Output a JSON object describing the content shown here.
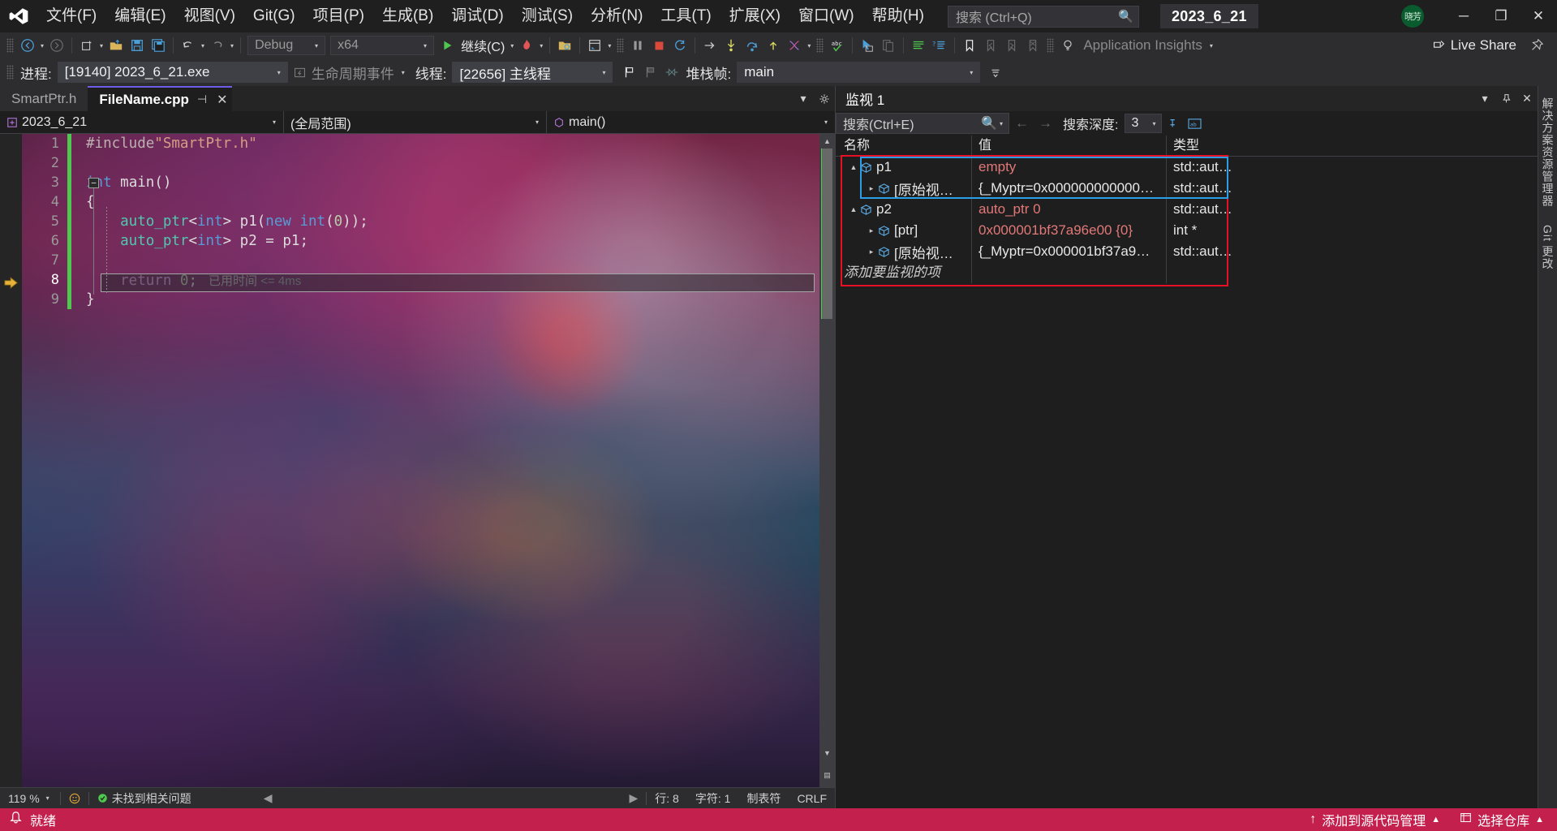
{
  "titlebar": {
    "logo_name": "visual-studio-logo",
    "menu": [
      {
        "label": "文件(F)"
      },
      {
        "label": "编辑(E)"
      },
      {
        "label": "视图(V)"
      },
      {
        "label": "Git(G)"
      },
      {
        "label": "项目(P)"
      },
      {
        "label": "生成(B)"
      },
      {
        "label": "调试(D)"
      },
      {
        "label": "测试(S)"
      },
      {
        "label": "分析(N)"
      },
      {
        "label": "工具(T)"
      },
      {
        "label": "扩展(X)"
      },
      {
        "label": "窗口(W)"
      },
      {
        "label": "帮助(H)"
      }
    ],
    "search_placeholder": "搜索 (Ctrl+Q)",
    "solution_name": "2023_6_21",
    "avatar_initials": "晓芳",
    "minimize": "─",
    "restore": "❐",
    "close": "✕"
  },
  "toolbar": {
    "config_value": "Debug",
    "platform_value": "x64",
    "continue_label": "继续(C)",
    "app_insights_label": "Application Insights",
    "live_share_label": "Live Share"
  },
  "context_bar": {
    "process_label": "进程:",
    "process_value": "[19140] 2023_6_21.exe",
    "lifecycle_label": "生命周期事件",
    "thread_label": "线程:",
    "thread_value": "[22656] 主线程",
    "stackframe_label": "堆栈帧:",
    "stackframe_value": "main"
  },
  "editor": {
    "tabs": [
      {
        "label": "SmartPtr.h",
        "active": false
      },
      {
        "label": "FileName.cpp",
        "active": true,
        "pin": "⊣",
        "close": "✕"
      }
    ],
    "nav": {
      "project": "2023_6_21",
      "scope": "(全局范围)",
      "member": "main()"
    },
    "lines": [
      {
        "n": "1",
        "tokens": [
          {
            "t": "#include",
            "c": "tk-pre"
          },
          {
            "t": "\"SmartPtr.h\"",
            "c": "tk-str"
          }
        ],
        "indent": 0
      },
      {
        "n": "2",
        "tokens": [],
        "indent": 0
      },
      {
        "n": "3",
        "tokens": [
          {
            "t": "int",
            "c": "tk-kw"
          },
          {
            "t": " ",
            "c": "tk-pun"
          },
          {
            "t": "main",
            "c": "tk-id"
          },
          {
            "t": "()",
            "c": "tk-pun"
          }
        ],
        "indent": 0
      },
      {
        "n": "4",
        "tokens": [
          {
            "t": "{",
            "c": "tk-pun"
          }
        ],
        "indent": 0
      },
      {
        "n": "5",
        "tokens": [
          {
            "t": "    auto_ptr",
            "c": "tk-type"
          },
          {
            "t": "<",
            "c": "tk-pun"
          },
          {
            "t": "int",
            "c": "tk-kw"
          },
          {
            "t": "> ",
            "c": "tk-pun"
          },
          {
            "t": "p1",
            "c": "tk-id"
          },
          {
            "t": "(",
            "c": "tk-pun"
          },
          {
            "t": "new",
            "c": "tk-kw"
          },
          {
            "t": " ",
            "c": "tk-pun"
          },
          {
            "t": "int",
            "c": "tk-kw"
          },
          {
            "t": "(",
            "c": "tk-pun"
          },
          {
            "t": "0",
            "c": "tk-num"
          },
          {
            "t": "));",
            "c": "tk-pun"
          }
        ],
        "indent": 0
      },
      {
        "n": "6",
        "tokens": [
          {
            "t": "    auto_ptr",
            "c": "tk-type"
          },
          {
            "t": "<",
            "c": "tk-pun"
          },
          {
            "t": "int",
            "c": "tk-kw"
          },
          {
            "t": "> ",
            "c": "tk-pun"
          },
          {
            "t": "p2",
            "c": "tk-id"
          },
          {
            "t": " = ",
            "c": "tk-pun"
          },
          {
            "t": "p1",
            "c": "tk-id"
          },
          {
            "t": ";",
            "c": "tk-pun"
          }
        ],
        "indent": 0
      },
      {
        "n": "7",
        "tokens": [],
        "indent": 0
      },
      {
        "n": "8",
        "tokens": [
          {
            "t": "    return",
            "c": "tk-ctl"
          },
          {
            "t": " ",
            "c": "tk-pun"
          },
          {
            "t": "0",
            "c": "tk-num"
          },
          {
            "t": ";",
            "c": "tk-pun"
          }
        ],
        "indent": 0
      },
      {
        "n": "9",
        "tokens": [
          {
            "t": "}",
            "c": "tk-pun"
          }
        ],
        "indent": 0
      }
    ],
    "elapsed_label": "已用时间",
    "elapsed_value": "<= 4ms",
    "current_line": 8,
    "status": {
      "zoom": "119 %",
      "problems": "未找到相关问题",
      "line": "行: 8",
      "col": "字符: 1",
      "tab": "制表符",
      "eol": "CRLF"
    }
  },
  "watch": {
    "title": "监视 1",
    "search_placeholder": "搜索(Ctrl+E)",
    "depth_label": "搜索深度:",
    "depth_value": "3",
    "nav_prev": "←",
    "nav_next": "→",
    "columns": [
      "名称",
      "值",
      "类型"
    ],
    "rows": [
      {
        "indent": 0,
        "expander": "▲",
        "icon": "cube-icon",
        "name": "p1",
        "value": "empty",
        "value_color": "red",
        "type": "std::aut…",
        "highlight": "blue-top"
      },
      {
        "indent": 1,
        "expander": "▸",
        "icon": "cube-icon",
        "name": "[原始视…",
        "value": "{_Myptr=0x000000000000…",
        "value_color": "white",
        "type": "std::aut…",
        "highlight": "blue-bottom"
      },
      {
        "indent": 0,
        "expander": "▲",
        "icon": "cube-icon",
        "name": "p2",
        "value": "auto_ptr 0",
        "value_color": "red",
        "type": "std::aut…",
        "highlight": "none"
      },
      {
        "indent": 1,
        "expander": "▸",
        "icon": "cube-icon",
        "name": "[ptr]",
        "value": "0x000001bf37a96e00 {0}",
        "value_color": "red",
        "type": "int *",
        "highlight": "none"
      },
      {
        "indent": 1,
        "expander": "▸",
        "icon": "cube-icon",
        "name": "[原始视…",
        "value": "{_Myptr=0x000001bf37a9…",
        "value_color": "white",
        "type": "std::aut…",
        "highlight": "none"
      }
    ],
    "add_row_label": "添加要监视的项"
  },
  "right_tabs": [
    {
      "label": "解决方案资源管理器"
    },
    {
      "label": "Git 更改"
    }
  ],
  "statusbar": {
    "ready_label": "就绪",
    "source_control_label": "添加到源代码管理",
    "repo_label": "选择仓库",
    "bell_icon": "bell-icon",
    "up_icon": "▲"
  },
  "colors": {
    "accent_purple": "#6c5ce7",
    "status_magenta": "#c4204d",
    "watch_outline_red": "#e81123",
    "watch_outline_blue": "#2b9ee8",
    "change_bar_green": "#4ec94e",
    "value_red": "#e27878"
  }
}
